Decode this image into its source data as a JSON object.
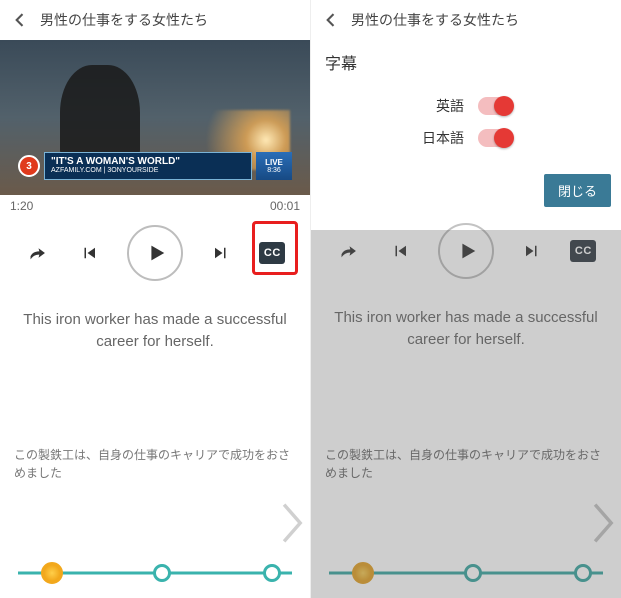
{
  "left": {
    "header": {
      "title": "男性の仕事をする女性たち"
    },
    "video": {
      "chyron_line1": "\"IT'S A WOMAN'S WORLD\"",
      "chyron_line2": "AZFAMILY.COM | 3ONYOURSIDE",
      "bug_text": "3",
      "live_label": "LIVE",
      "live_time": "8:36"
    },
    "time": {
      "current": "1:20",
      "remaining": "00:01"
    },
    "controls": {
      "cc_label": "CC"
    },
    "subtitle_en": "This iron worker has made a successful career for herself.",
    "subtitle_ja": "この製鉄工は、自身の仕事のキャリアで成功をおさめました"
  },
  "right": {
    "header": {
      "title": "男性の仕事をする女性たち"
    },
    "panel_title": "字幕",
    "options": {
      "english_label": "英語",
      "japanese_label": "日本語"
    },
    "close_label": "閉じる",
    "controls": {
      "cc_label": "CC"
    },
    "subtitle_en": "This iron worker has made a successful career for herself.",
    "subtitle_ja": "この製鉄工は、自身の仕事のキャリアで成功をおさめました"
  }
}
